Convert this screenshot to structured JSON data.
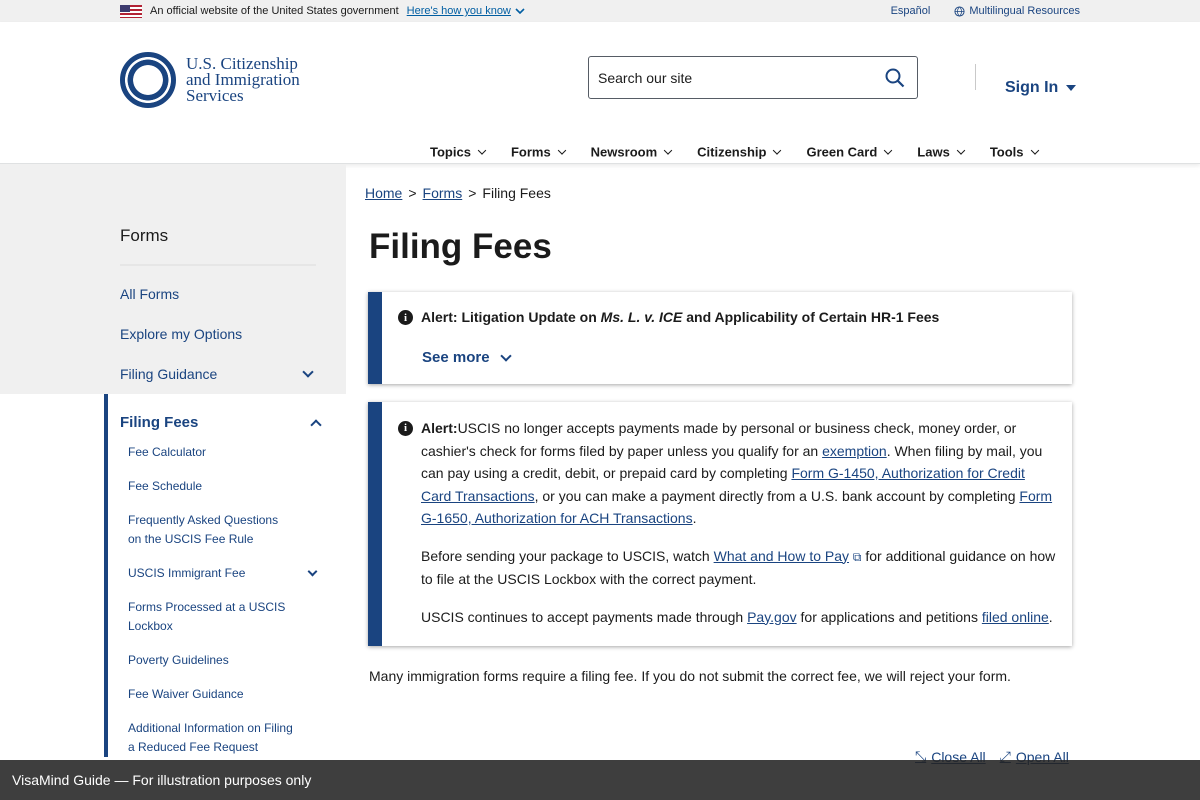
{
  "gov_banner": {
    "official_text": "An official website of the United States government",
    "how_you_know": "Here's how you know",
    "espanol": "Español",
    "multilingual": "Multilingual Resources"
  },
  "header": {
    "logo_line1": "U.S. Citizenship",
    "logo_line2": "and Immigration",
    "logo_line3": "Services",
    "search_placeholder": "Search our site",
    "sign_in": "Sign In"
  },
  "nav": [
    "Topics",
    "Forms",
    "Newsroom",
    "Citizenship",
    "Green Card",
    "Laws",
    "Tools"
  ],
  "sidebar": {
    "heading": "Forms",
    "links": [
      "All Forms",
      "Explore my Options",
      "Filing Guidance"
    ],
    "active_title": "Filing Fees",
    "sub_items": [
      "Fee Calculator",
      "Fee Schedule",
      "Frequently Asked Questions on the USCIS Fee Rule",
      "USCIS Immigrant Fee",
      "Forms Processed at a USCIS Lockbox",
      "Poverty Guidelines",
      "Fee Waiver Guidance",
      "Additional Information on Filing a Reduced Fee Request"
    ]
  },
  "breadcrumb": {
    "home": "Home",
    "forms": "Forms",
    "current": "Filing Fees",
    "sep": ">"
  },
  "page_title": "Filing Fees",
  "alert1": {
    "label": "Alert",
    "text_a": ": Litigation Update on ",
    "case": "Ms. L. v. ICE",
    "text_b": " and Applicability of Certain HR-1 Fees",
    "see_more": "See more"
  },
  "alert2": {
    "label": "Alert:",
    "p1_a": "USCIS no longer accepts payments made by personal or business check, money order, or cashier's check for forms filed by paper unless you qualify for an ",
    "p1_link1": "exemption",
    "p1_b": ". When filing by mail, you can pay using a credit, debit, or prepaid card by completing ",
    "p1_link2": "Form G-1450, Authorization for Credit Card Transactions",
    "p1_c": ", or you can make a payment directly from a U.S. bank account by completing ",
    "p1_link3": "Form G-1650, Authorization for ACH Transactions",
    "p1_d": ".",
    "p2_a": "Before sending your package to USCIS, watch ",
    "p2_link": "What and How to Pay",
    "p2_b": " for additional guidance on how to file at the USCIS Lockbox with the correct payment.",
    "p3_a": "USCIS continues to accept payments made through ",
    "p3_link1": "Pay.gov",
    "p3_b": " for applications and petitions ",
    "p3_link2": "filed online",
    "p3_c": "."
  },
  "intro": "Many immigration forms require a filing fee. If you do not submit the correct fee, we will reject your form.",
  "accordion_controls": {
    "close_all": "Close All",
    "open_all": "Open All"
  },
  "watermark": "VisaMind Guide — For illustration purposes only"
}
